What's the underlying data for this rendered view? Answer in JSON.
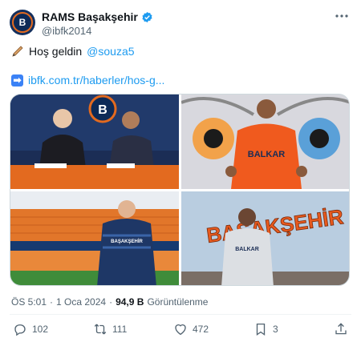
{
  "author": {
    "display_name": "RAMS Başakşehir",
    "handle": "@ibfk2014",
    "avatar_icon": "club-logo-icon",
    "avatar_letter": "B",
    "verified": true
  },
  "tweet": {
    "line1_prefix": "Hoş geldin",
    "mention": "@souza5",
    "link_text": "ibfk.com.tr/haberler/hos-g...",
    "emoji1": "pen-emoji-icon",
    "emoji2": "right-arrow-emoji-icon"
  },
  "media": {
    "count": 4,
    "images": [
      {
        "icon": "signing-photo"
      },
      {
        "icon": "jersey-presentation-photo",
        "jersey_text": "BALKAR"
      },
      {
        "icon": "stadium-photo",
        "jersey_text": "BAŞAKŞEHİR"
      },
      {
        "icon": "wall-mural-photo",
        "wall_text": "BAŞAKŞEHİR",
        "jersey_text": "BALKAR"
      }
    ]
  },
  "meta": {
    "time": "ÖS 5:01",
    "separator": "·",
    "date": "1 Oca 2024",
    "separator2": "·",
    "views": "94,9 B",
    "views_label": "Görüntülenme"
  },
  "actions": {
    "replies": "102",
    "retweets": "111",
    "likes": "472",
    "bookmarks": "3"
  },
  "colors": {
    "accent": "#1d9bf0",
    "verified": "#1d9bf0",
    "muted": "#536471",
    "club_orange": "#e36a1f",
    "club_navy": "#0d2a57"
  }
}
